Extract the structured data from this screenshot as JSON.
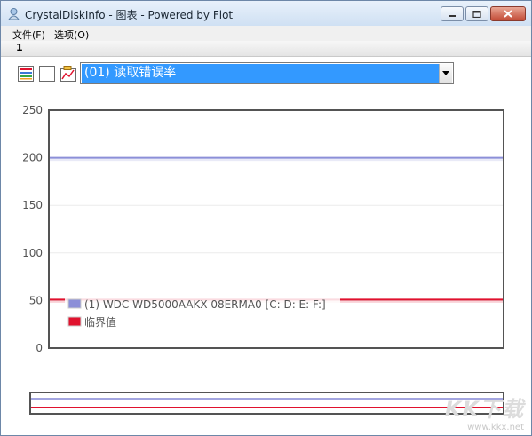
{
  "window": {
    "title": "CrystalDiskInfo - 图表 - Powered by Flot"
  },
  "menu": {
    "items": [
      "文件(F)",
      "选项(O)"
    ]
  },
  "tabs": {
    "active": "1"
  },
  "toolbar": {
    "icons": [
      "multi-color-chart-icon",
      "blank-chart-icon",
      "settings-chart-icon"
    ],
    "selector_value": "(01) 读取错误率"
  },
  "colors": {
    "series": "#8c8fd8",
    "threshold": "#e0122e",
    "accent": "#3399ff"
  },
  "chart_data": {
    "type": "line",
    "yticks": [
      0,
      50,
      100,
      150,
      200,
      250
    ],
    "ylim": [
      0,
      250
    ],
    "grid": true,
    "legend_position": "bottom-left",
    "series": [
      {
        "name": "(1) WDC WD5000AAKX-08ERMA0 [C: D: E: F:]",
        "values": [
          200,
          200
        ]
      },
      {
        "name": "临界值",
        "values": [
          51,
          51
        ]
      }
    ]
  },
  "watermark": {
    "logo": "KK下载",
    "url": "www.kkx.net"
  }
}
